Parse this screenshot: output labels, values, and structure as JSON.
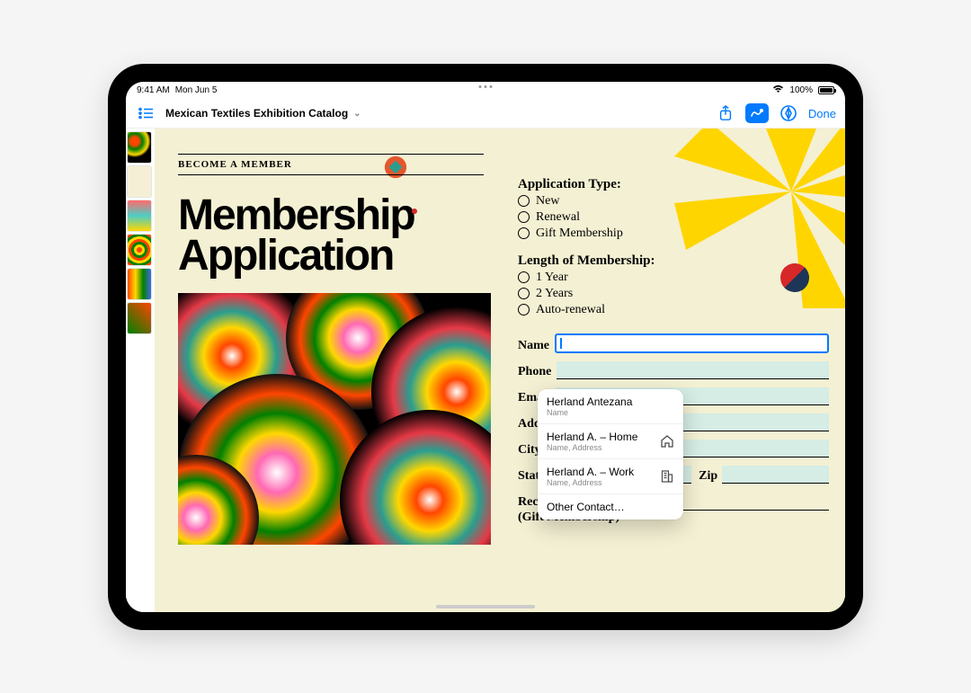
{
  "status": {
    "time": "9:41 AM",
    "date": "Mon Jun 5",
    "battery_pct": "100%"
  },
  "toolbar": {
    "doc_title": "Mexican Textiles Exhibition Catalog",
    "done": "Done"
  },
  "doc": {
    "become": "BECOME A MEMBER",
    "title_line1": "Membership",
    "title_line2": "Application",
    "app_type_head": "Application Type:",
    "app_type_options": {
      "0": "New",
      "1": "Renewal",
      "2": "Gift Membership"
    },
    "length_head": "Length of Membership:",
    "length_options": {
      "0": "1 Year",
      "1": "2 Years",
      "2": "Auto-renewal"
    },
    "fields": {
      "name": "Name",
      "phone": "Phone",
      "email": "Email",
      "address": "Address",
      "city": "City",
      "state": "State",
      "zip": "Zip"
    },
    "recipient_line1": "Recipient's Name",
    "recipient_line2": "(Gift Membership)"
  },
  "autofill": {
    "i0": {
      "title": "Herland Antezana",
      "sub": "Name"
    },
    "i1": {
      "title": "Herland A. – Home",
      "sub": "Name, Address"
    },
    "i2": {
      "title": "Herland A. – Work",
      "sub": "Name, Address"
    },
    "other": "Other Contact…"
  }
}
